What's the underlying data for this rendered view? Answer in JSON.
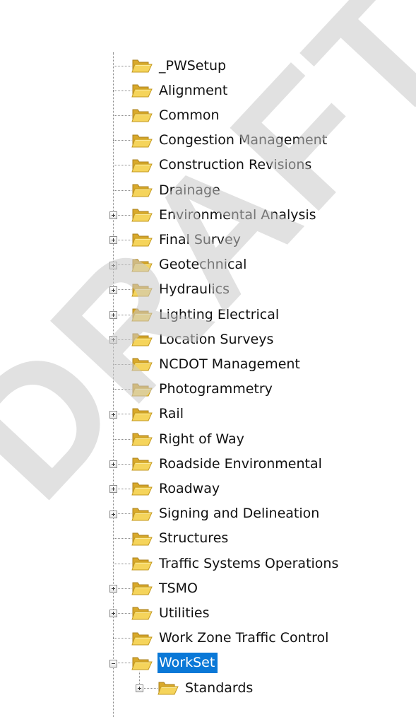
{
  "tree": {
    "items": [
      {
        "label": "_PWSetup",
        "expandable": false
      },
      {
        "label": "Alignment",
        "expandable": false
      },
      {
        "label": "Common",
        "expandable": false
      },
      {
        "label": "Congestion Management",
        "expandable": false
      },
      {
        "label": "Construction Revisions",
        "expandable": false
      },
      {
        "label": "Drainage",
        "expandable": false
      },
      {
        "label": "Environmental Analysis",
        "expandable": true
      },
      {
        "label": "Final Survey",
        "expandable": true
      },
      {
        "label": "Geotechnical",
        "expandable": true
      },
      {
        "label": "Hydraulics",
        "expandable": true
      },
      {
        "label": "Lighting Electrical",
        "expandable": true
      },
      {
        "label": "Location Surveys",
        "expandable": true
      },
      {
        "label": "NCDOT Management",
        "expandable": false
      },
      {
        "label": "Photogrammetry",
        "expandable": false
      },
      {
        "label": "Rail",
        "expandable": true
      },
      {
        "label": "Right of Way",
        "expandable": false
      },
      {
        "label": "Roadside Environmental",
        "expandable": true
      },
      {
        "label": "Roadway",
        "expandable": true
      },
      {
        "label": "Signing and Delineation",
        "expandable": true
      },
      {
        "label": "Structures",
        "expandable": false
      },
      {
        "label": "Traffic Systems Operations",
        "expandable": false
      },
      {
        "label": "TSMO",
        "expandable": true
      },
      {
        "label": "Utilities",
        "expandable": true
      },
      {
        "label": "Work Zone Traffic Control",
        "expandable": false
      },
      {
        "label": "WorkSet",
        "expandable": true,
        "expanded": true,
        "selected": true,
        "children": [
          {
            "label": "Standards",
            "expandable": true
          }
        ]
      }
    ],
    "selection_color": "#0a78d7",
    "folder_icon": "open-folder-icon"
  },
  "watermark": {
    "text": "DRAFT",
    "color": "#c8c8c8"
  }
}
